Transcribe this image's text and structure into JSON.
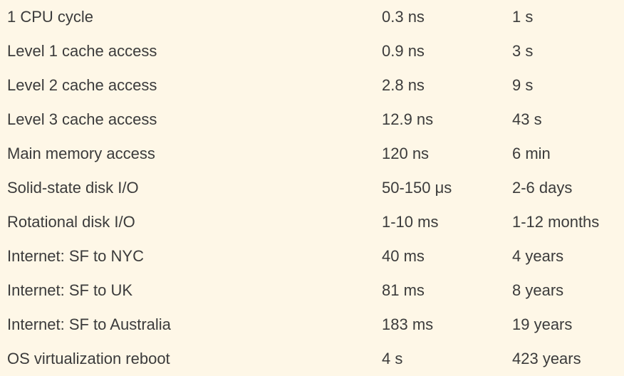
{
  "rows": [
    {
      "operation": "1 CPU cycle",
      "latency": "0.3 ns",
      "scaled": "1 s"
    },
    {
      "operation": "Level 1 cache access",
      "latency": "0.9 ns",
      "scaled": "3 s"
    },
    {
      "operation": "Level 2 cache access",
      "latency": "2.8 ns",
      "scaled": "9 s"
    },
    {
      "operation": "Level 3 cache access",
      "latency": "12.9 ns",
      "scaled": "43 s"
    },
    {
      "operation": "Main memory access",
      "latency": "120 ns",
      "scaled": "6 min"
    },
    {
      "operation": "Solid-state disk I/O",
      "latency": "50-150 μs",
      "scaled": "2-6 days"
    },
    {
      "operation": "Rotational disk I/O",
      "latency": "1-10 ms",
      "scaled": "1-12 months"
    },
    {
      "operation": "Internet: SF to NYC",
      "latency": "40 ms",
      "scaled": "4 years"
    },
    {
      "operation": "Internet: SF to UK",
      "latency": "81 ms",
      "scaled": "8 years"
    },
    {
      "operation": "Internet: SF to Australia",
      "latency": "183 ms",
      "scaled": "19 years"
    },
    {
      "operation": "OS virtualization reboot",
      "latency": "4 s",
      "scaled": "423 years"
    }
  ]
}
